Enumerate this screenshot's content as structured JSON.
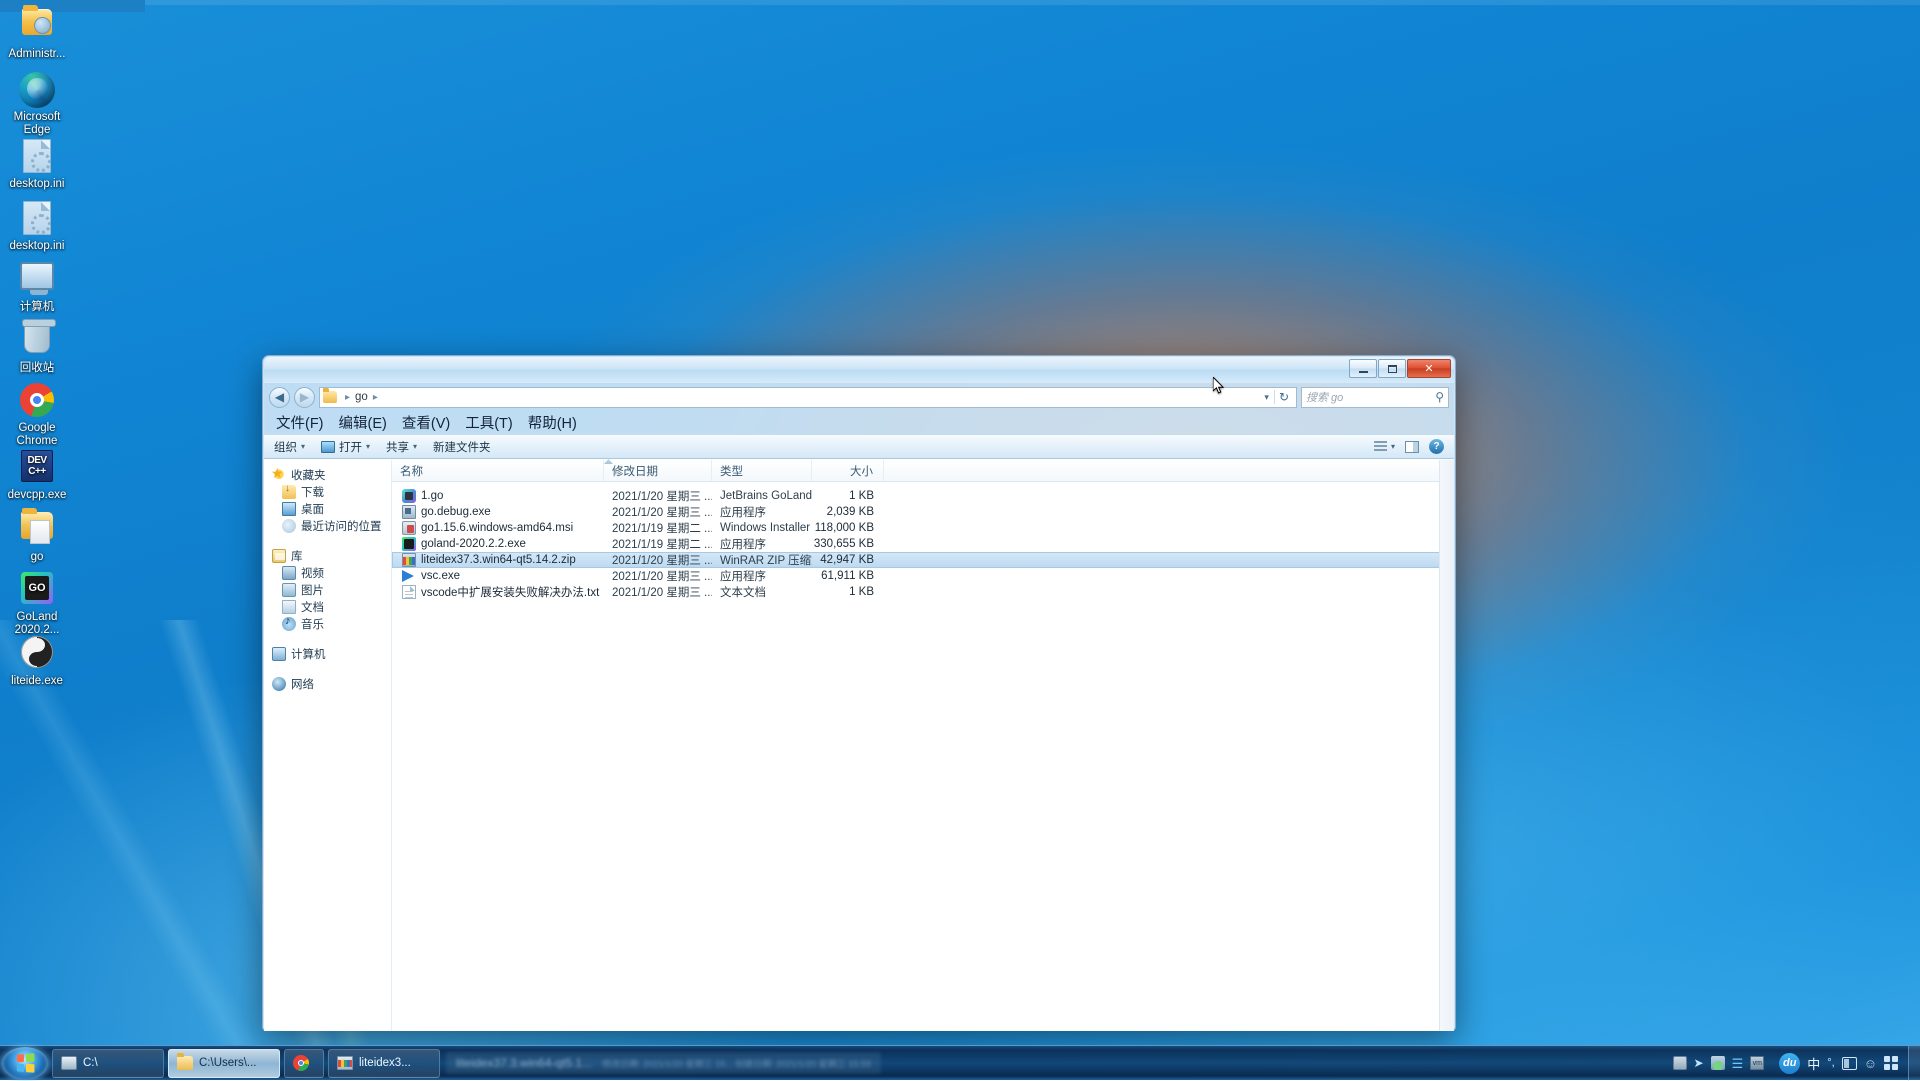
{
  "desktop": {
    "icons": [
      {
        "label": "Administr...",
        "icon": "user-folder-icon",
        "cls": "adm"
      },
      {
        "label": "Microsoft Edge",
        "icon": "edge-icon",
        "cls": "edge"
      },
      {
        "label": "desktop.ini",
        "icon": "ini-file-icon",
        "cls": "ini"
      },
      {
        "label": "desktop.ini",
        "icon": "ini-file-icon",
        "cls": "ini"
      },
      {
        "label": "计算机",
        "icon": "computer-icon",
        "cls": "pc"
      },
      {
        "label": "回收站",
        "icon": "recycle-bin-icon",
        "cls": "bin"
      },
      {
        "label": "Google Chrome",
        "icon": "chrome-icon",
        "cls": "chrome"
      },
      {
        "label": "devcpp.exe",
        "icon": "devcpp-icon",
        "cls": "dev"
      },
      {
        "label": "go",
        "icon": "folder-icon",
        "cls": "gofold"
      },
      {
        "label": "GoLand 2020.2...",
        "icon": "goland-icon",
        "cls": "goland"
      },
      {
        "label": "liteide.exe",
        "icon": "liteide-icon",
        "cls": "lite"
      }
    ]
  },
  "window": {
    "title": "",
    "buttons": {
      "minimize": "–",
      "maximize": "□",
      "close": "✕"
    },
    "nav": {
      "back": "◀",
      "forward": "▶"
    },
    "breadcrumb": {
      "root": "",
      "sep": "▸",
      "items": [
        "go"
      ],
      "dropdown": "▾",
      "refresh": "↻"
    },
    "search": {
      "placeholder": "搜索 go",
      "icon": "⚲"
    },
    "menus": [
      "文件(F)",
      "编辑(E)",
      "查看(V)",
      "工具(T)",
      "帮助(H)"
    ],
    "toolbar": {
      "organize": "组织",
      "open": "打开",
      "share": "共享",
      "new_folder": "新建文件夹",
      "caret": "▾",
      "view_icon": "view-options-icon",
      "preview_icon": "preview-pane-icon",
      "help_icon": "?"
    }
  },
  "navpane": {
    "groups": [
      {
        "header": {
          "label": "收藏夹",
          "icon": "star-icon",
          "cls": "ni-star"
        },
        "items": [
          {
            "label": "下载",
            "icon": "downloads-icon",
            "cls": "ni-dl"
          },
          {
            "label": "桌面",
            "icon": "desktop-icon",
            "cls": "ni-desk"
          },
          {
            "label": "最近访问的位置",
            "icon": "recent-places-icon",
            "cls": "ni-recent"
          }
        ]
      },
      {
        "header": {
          "label": "库",
          "icon": "libraries-icon",
          "cls": "ni-lib"
        },
        "items": [
          {
            "label": "视频",
            "icon": "videos-icon",
            "cls": "ni-vid"
          },
          {
            "label": "图片",
            "icon": "pictures-icon",
            "cls": "ni-pic"
          },
          {
            "label": "文档",
            "icon": "documents-icon",
            "cls": "ni-doc"
          },
          {
            "label": "音乐",
            "icon": "music-icon",
            "cls": "ni-mus"
          }
        ]
      },
      {
        "header": {
          "label": "计算机",
          "icon": "computer-icon",
          "cls": "ni-comp"
        },
        "items": []
      },
      {
        "header": {
          "label": "网络",
          "icon": "network-icon",
          "cls": "ni-net"
        },
        "items": []
      }
    ]
  },
  "filelist": {
    "columns": [
      "名称",
      "修改日期",
      "类型",
      "大小"
    ],
    "sorted_by": "名称",
    "rows": [
      {
        "name": "1.go",
        "date": "2021/1/20 星期三 ...",
        "type": "JetBrains GoLand",
        "size": "1 KB",
        "icon": "go-file-icon",
        "cls": "fi-go",
        "selected": false
      },
      {
        "name": "go.debug.exe",
        "date": "2021/1/20 星期三 ...",
        "type": "应用程序",
        "size": "2,039 KB",
        "icon": "exe-file-icon",
        "cls": "fi-exe",
        "selected": false
      },
      {
        "name": "go1.15.6.windows-amd64.msi",
        "date": "2021/1/19 星期二 ...",
        "type": "Windows Installer ...",
        "size": "118,000 KB",
        "icon": "msi-file-icon",
        "cls": "fi-msi",
        "selected": false
      },
      {
        "name": "goland-2020.2.2.exe",
        "date": "2021/1/19 星期二 ...",
        "type": "应用程序",
        "size": "330,655 KB",
        "icon": "goland-file-icon",
        "cls": "fi-goland",
        "selected": false
      },
      {
        "name": "liteidex37.3.win64-qt5.14.2.zip",
        "date": "2021/1/20 星期三 ...",
        "type": "WinRAR ZIP 压缩文...",
        "size": "42,947 KB",
        "icon": "zip-file-icon",
        "cls": "fi-zip",
        "selected": true
      },
      {
        "name": "vsc.exe",
        "date": "2021/1/20 星期三 ...",
        "type": "应用程序",
        "size": "61,911 KB",
        "icon": "vscode-file-icon",
        "cls": "fi-vsc",
        "selected": false
      },
      {
        "name": "vscode中扩展安装失败解决办法.txt",
        "date": "2021/1/20 星期三 ...",
        "type": "文本文档",
        "size": "1 KB",
        "icon": "txt-file-icon",
        "cls": "fi-txt",
        "selected": false
      }
    ]
  },
  "taskbar": {
    "start": "start-orb",
    "buttons": [
      {
        "label": "C:\\",
        "icon": "drive-icon",
        "cls": "ti-drive",
        "active": false
      },
      {
        "label": "C:\\Users\\...",
        "icon": "folder-icon",
        "cls": "ti-folder",
        "active": true
      },
      {
        "label": "",
        "icon": "chrome-icon",
        "cls": "ti-chrome",
        "active": false
      },
      {
        "label": "liteidex3...",
        "icon": "winrar-icon",
        "cls": "ti-rar",
        "active": false
      }
    ],
    "tooltip": {
      "title": "liteidex37.3.win64-qt5.1...",
      "sub": "修改日期: 2021/1/20 星期三 15...  创建日期: 2021/1/20 星期三 15:59"
    },
    "tray": {
      "icons": [
        "keyboard-icon",
        "cursor-icon",
        "network-icon",
        "bluetooth-icon",
        "vm-icon"
      ],
      "baidu": "du",
      "ime": "中",
      "ime_punct": "°,",
      "pane_icon": "ime-pane-icon",
      "person_icon": "☺",
      "grid_icon": "ime-grid-icon"
    }
  }
}
